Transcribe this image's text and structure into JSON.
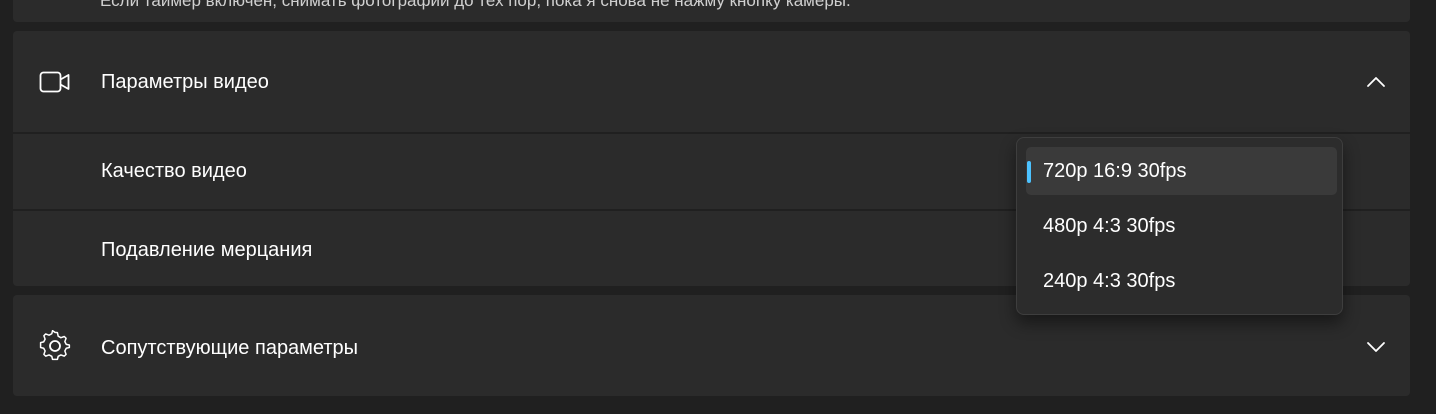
{
  "top_card": {
    "description": "Если таймер включен, снимать фотографии до тех пор, пока я снова не нажму кнопку камеры."
  },
  "video_settings": {
    "title": "Параметры видео",
    "icon": "video-camera-icon",
    "expanded": true,
    "rows": [
      {
        "label": "Качество видео"
      },
      {
        "label": "Подавление мерцания"
      }
    ]
  },
  "related_settings": {
    "title": "Сопутствующие параметры",
    "icon": "gear-icon",
    "expanded": false
  },
  "quality_dropdown": {
    "options": [
      {
        "label": "720p 16:9 30fps",
        "selected": true
      },
      {
        "label": "480p 4:3 30fps",
        "selected": false
      },
      {
        "label": "240p 4:3 30fps",
        "selected": false
      }
    ],
    "accent_color": "#4cc2ff"
  }
}
